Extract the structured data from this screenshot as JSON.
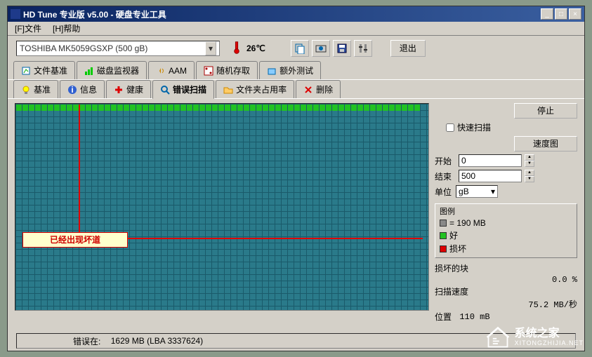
{
  "window": {
    "title": "HD Tune 专业版 v5.00 - 硬盘专业工具",
    "min": "_",
    "max": "□",
    "close": "×"
  },
  "menu": {
    "file": "[F]文件",
    "help": "[H]帮助"
  },
  "drive": {
    "selected": "TOSHIBA MK5059GSXP (500 gB)"
  },
  "temp": {
    "value": "26℃"
  },
  "exit_label": "退出",
  "tabs_row1": [
    {
      "icon": "bench",
      "label": "文件基准"
    },
    {
      "icon": "monitor",
      "label": "磁盘监视器"
    },
    {
      "icon": "aam",
      "label": "AAM"
    },
    {
      "icon": "random",
      "label": "随机存取"
    },
    {
      "icon": "extra",
      "label": "额外测试"
    }
  ],
  "tabs_row2": [
    {
      "icon": "bulb",
      "label": "基准"
    },
    {
      "icon": "info",
      "label": "信息"
    },
    {
      "icon": "health",
      "label": "健康"
    },
    {
      "icon": "scan",
      "label": "错误扫描",
      "active": true
    },
    {
      "icon": "folder",
      "label": "文件夹占用率"
    },
    {
      "icon": "erase",
      "label": "删除"
    }
  ],
  "controls": {
    "stop": "停止",
    "quick_scan": "快速扫描",
    "speedmap": "速度图",
    "start_label": "开始",
    "start_value": "0",
    "end_label": "结束",
    "end_value": "500",
    "unit_label": "单位",
    "unit_value": "gB"
  },
  "legend": {
    "title": "图例",
    "blocksize": "= 190 MB",
    "ok": "好",
    "bad": "损坏"
  },
  "stats": {
    "damaged_label": "损坏的块",
    "damaged_value": "0.0 %",
    "speed_label": "扫描速度",
    "speed_value": "75.2 MB/秒",
    "position_label": "位置",
    "position_value": "110 mB"
  },
  "status": {
    "error_at": "错误在:",
    "error_value": "1629 MB (LBA 3337624)"
  },
  "callout": {
    "text": "已经出现坏道"
  },
  "watermark": {
    "name": "系统之家",
    "url": "XITONGZHIJIA.NET"
  }
}
